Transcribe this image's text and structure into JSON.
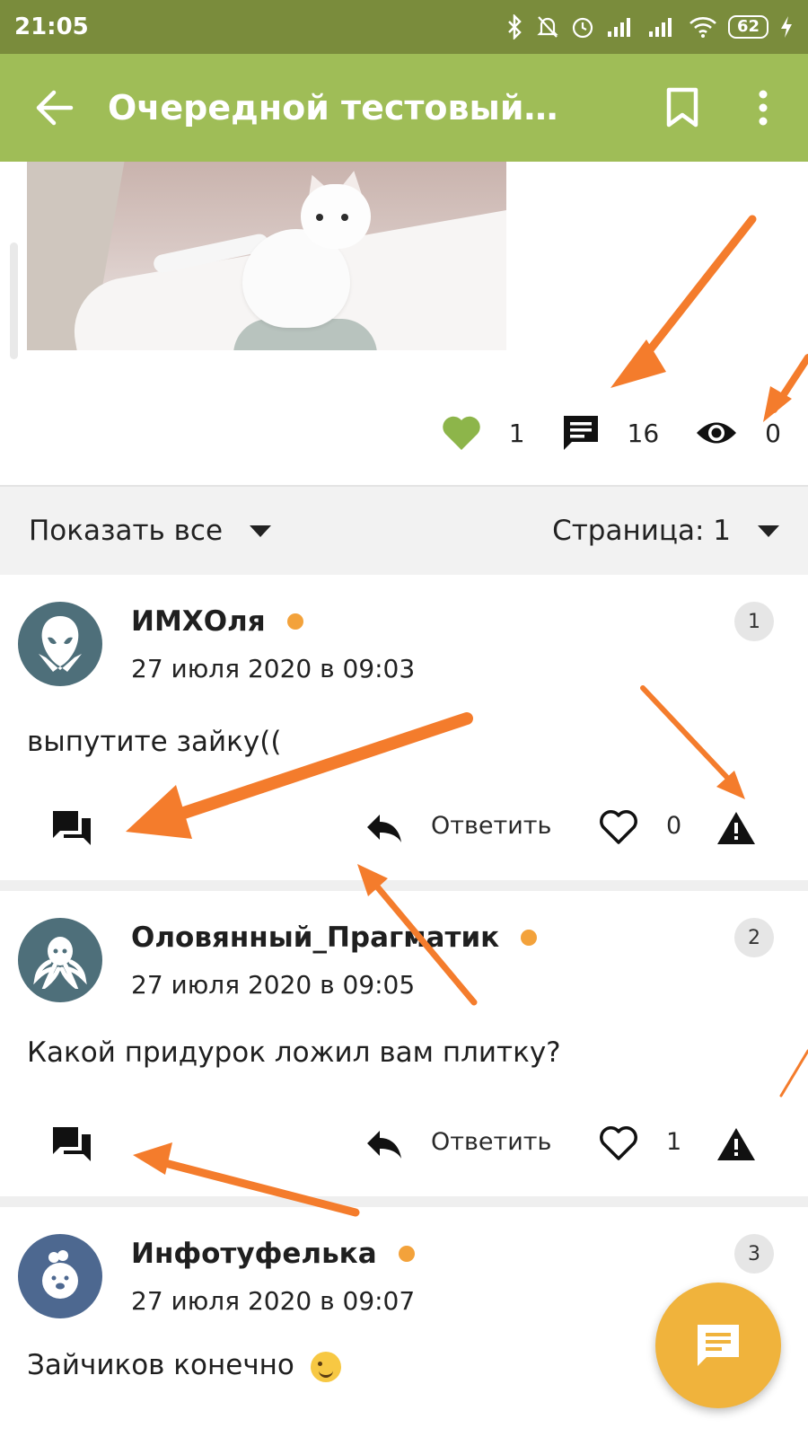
{
  "status_bar": {
    "time": "21:05",
    "battery": "62",
    "icons": [
      "bluetooth-icon",
      "mute-icon",
      "alarm-icon",
      "signal-icon",
      "signal-icon",
      "wifi-icon",
      "battery-icon",
      "charging-icon"
    ]
  },
  "app_bar": {
    "title": "Очередной тестовый…",
    "icons": [
      "back-arrow-icon",
      "bookmark-icon",
      "more-vert-icon"
    ]
  },
  "post": {
    "image": "cat-in-bathtub-photo",
    "stats": {
      "likes": "1",
      "comments": "16",
      "views": "0"
    }
  },
  "filter": {
    "show_label": "Показать все",
    "page_label": "Страница: 1"
  },
  "comments": [
    {
      "author": "ИМХОля",
      "date": "27 июля 2020 в 09:03",
      "number": "1",
      "text": "выпутите зайку((",
      "reply_label": "Ответить",
      "likes": "0"
    },
    {
      "author": "Оловянный_Прагматик",
      "date": "27 июля 2020 в 09:05",
      "number": "2",
      "text": "Какой придурок ложил вам плитку?",
      "reply_label": "Ответить",
      "likes": "1"
    },
    {
      "author": "Инфотуфелька",
      "date": "27 июля 2020 в 09:07",
      "number": "3",
      "text": "Зайчиков конечно"
    }
  ],
  "colors": {
    "status_bar": "#7a8c3c",
    "app_bar": "#9fbd57",
    "heart_green": "#8db54a",
    "online": "#f3a23b",
    "fab": "#f0b33c",
    "arrow": "#f47c2c"
  }
}
